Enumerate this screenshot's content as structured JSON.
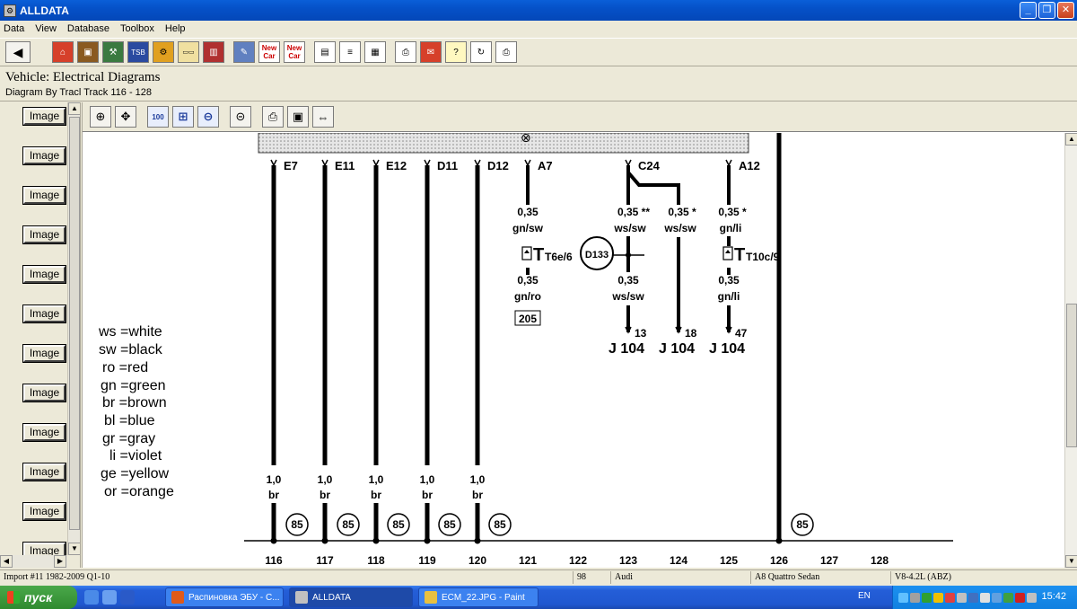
{
  "window": {
    "title": "ALLDATA",
    "minimize": "_",
    "maximize": "❐",
    "close": "✕"
  },
  "menu": [
    "Data",
    "View",
    "Database",
    "Toolbox",
    "Help"
  ],
  "toolbar": {
    "back": "◀",
    "new_car_1": "New Car",
    "new_car_2": "New Car",
    "icons": [
      "home-icon",
      "folder-icon",
      "components-icon",
      "tsb-icon",
      "diagnostics-icon",
      "parts-icon",
      "manual-icon",
      "tools-icon",
      "new-car-icon",
      "new-car-alt-icon",
      "split-view-icon",
      "text-view-icon",
      "camera-icon",
      "print-icon",
      "note-icon",
      "help-icon",
      "refresh-icon",
      "printer-alt-icon"
    ]
  },
  "vehicle": {
    "title": "Vehicle:  Electrical Diagrams",
    "subtitle": "Diagram By Tracl  Track 116 - 128"
  },
  "left_panel": {
    "image_buttons": [
      "Image",
      "Image",
      "Image",
      "Image",
      "Image",
      "Image",
      "Image",
      "Image",
      "Image",
      "Image",
      "Image",
      "Image"
    ]
  },
  "diagram_toolbar": {
    "icons": [
      "zoom-in-icon",
      "pan-icon",
      "zoom-100-icon",
      "zoom-fit-icon",
      "zoom-out-icon",
      "magnify-icon",
      "print-icon",
      "camera-icon",
      "camera-fit-icon"
    ],
    "zoom_100": "100"
  },
  "diagram": {
    "connectors_top": [
      "E7",
      "E11",
      "E12",
      "D11",
      "D12",
      "A7",
      "C24",
      "A12"
    ],
    "bus_symbol": "⊗",
    "wire_specs_upper": [
      {
        "size": "0,35",
        "color": "gn/sw"
      },
      {
        "size": "0,35 **",
        "color": "ws/sw"
      },
      {
        "size": "0,35 *",
        "color": "ws/sw"
      },
      {
        "size": "0,35 *",
        "color": "gn/li"
      }
    ],
    "wire_specs_mid": [
      {
        "size": "0,35",
        "color": "gn/ro"
      },
      {
        "size": "0,35",
        "color": "ws/sw"
      },
      {
        "size": "0,35",
        "color": "gn/li"
      }
    ],
    "connector_t1": "T6e/6",
    "connector_t2": "T10c/9",
    "splice": "D133",
    "ref_205": "205",
    "pins": [
      "13",
      "18",
      "47"
    ],
    "ecu": [
      "J 104",
      "J 104",
      "J 104"
    ],
    "legend": [
      "ws =white",
      "sw =black",
      " ro =red",
      " gn =green",
      " br =brown",
      " bl =blue",
      " gr =gray",
      "  li =violet",
      " ge =yellow",
      " or =orange"
    ],
    "ground_specs": [
      {
        "size": "1,0",
        "color": "br"
      },
      {
        "size": "1,0",
        "color": "br"
      },
      {
        "size": "1,0",
        "color": "br"
      },
      {
        "size": "1,0",
        "color": "br"
      },
      {
        "size": "1,0",
        "color": "br"
      }
    ],
    "ground_labels": [
      "85",
      "85",
      "85",
      "85",
      "85",
      "85"
    ],
    "tracks": [
      "116",
      "117",
      "118",
      "119",
      "120",
      "121",
      "122",
      "123",
      "124",
      "125",
      "126",
      "127",
      "128"
    ]
  },
  "status": {
    "import": "Import #11 1982-2009 Q1-10",
    "num": "98",
    "make": "Audi",
    "model": "A8 Quattro Sedan",
    "engine": "V8-4.2L (ABZ)"
  },
  "taskbar": {
    "start": "пуск",
    "tasks": [
      "Распиновка ЭБУ - С...",
      "ALLDATA",
      "ECM_22.JPG - Paint"
    ],
    "lang": "EN",
    "clock": "15:42"
  }
}
